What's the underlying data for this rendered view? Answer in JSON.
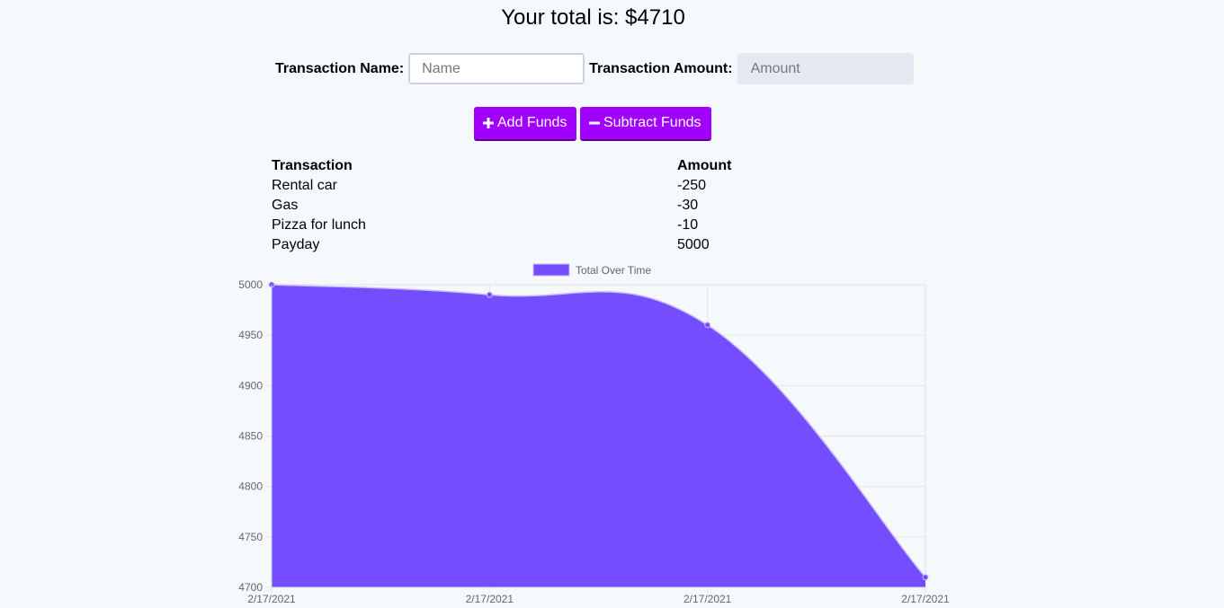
{
  "header": {
    "total_text": "Your total is: $4710"
  },
  "form": {
    "name_label": "Transaction Name:",
    "name_placeholder": "Name",
    "name_value": "",
    "amount_label": "Transaction Amount:",
    "amount_placeholder": "Amount",
    "amount_value": ""
  },
  "buttons": {
    "add_label": "Add Funds",
    "add_icon": "plus-icon",
    "subtract_label": "Subtract Funds",
    "subtract_icon": "minus-icon"
  },
  "table": {
    "headers": [
      "Transaction",
      "Amount"
    ],
    "rows": [
      {
        "name": "Rental car",
        "amount": "-250"
      },
      {
        "name": "Gas",
        "amount": "-30"
      },
      {
        "name": "Pizza for lunch",
        "amount": "-10"
      },
      {
        "name": "Payday",
        "amount": "5000"
      }
    ]
  },
  "colors": {
    "button": "#a100ff",
    "chart_fill": "#744dff",
    "background": "#f6f9fc"
  },
  "chart_data": {
    "type": "area",
    "x": [
      "2/17/2021",
      "2/17/2021",
      "2/17/2021",
      "2/17/2021"
    ],
    "series": [
      {
        "name": "Total Over Time",
        "values": [
          5000,
          4990,
          4960,
          4710
        ]
      }
    ],
    "ylim": [
      4700,
      5000
    ],
    "yticks": [
      4700,
      4750,
      4800,
      4850,
      4900,
      4950,
      5000
    ],
    "grid": true,
    "legend": "top-center"
  }
}
